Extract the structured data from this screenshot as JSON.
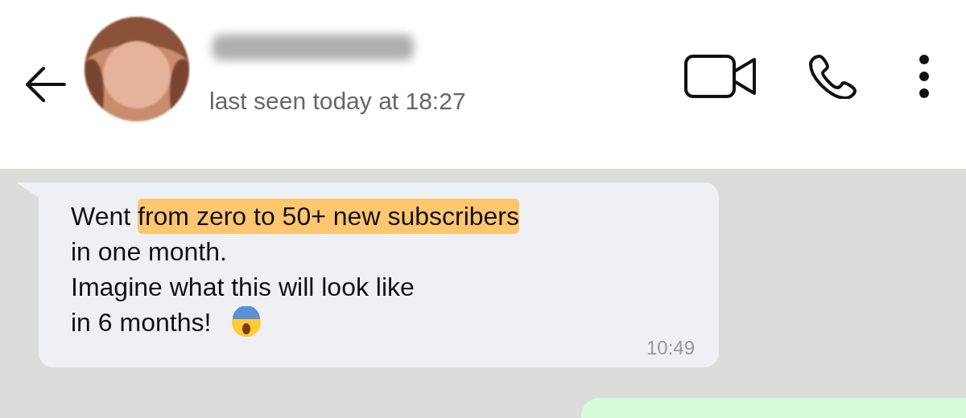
{
  "header": {
    "status": "last seen today at 18:27"
  },
  "message": {
    "lines": [
      {
        "segments": [
          {
            "text": "Went ",
            "highlighted": false
          },
          {
            "text": "from zero to 50+ new subscribers",
            "highlighted": true
          }
        ]
      },
      {
        "segments": [
          {
            "text": "in one month.",
            "highlighted": false
          }
        ]
      },
      {
        "segments": [
          {
            "text": "Imagine what this will look like",
            "highlighted": false
          }
        ]
      },
      {
        "segments": [
          {
            "text": "in 6 months!",
            "highlighted": false
          }
        ],
        "emoji": true
      }
    ],
    "time": "10:49"
  }
}
